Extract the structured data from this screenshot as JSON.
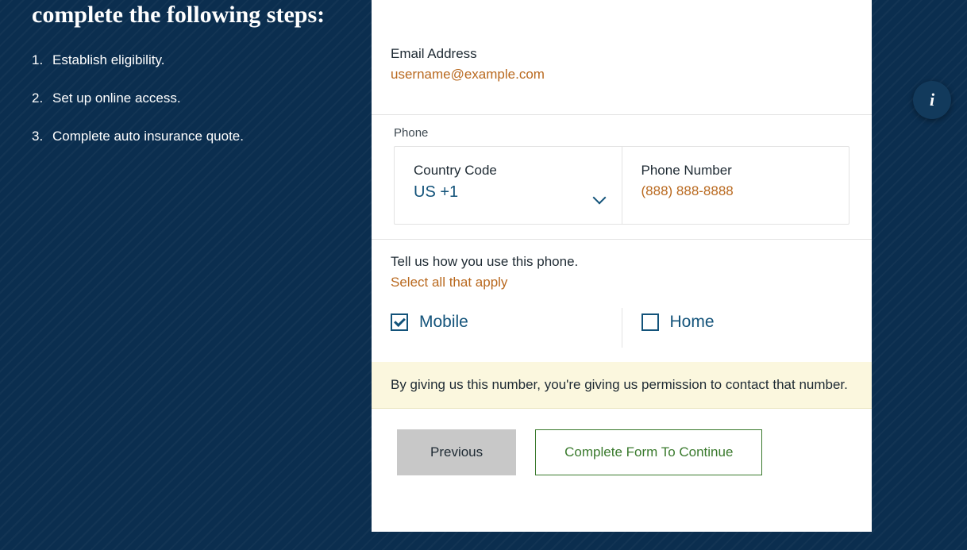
{
  "sidebar": {
    "heading": "complete the following steps:",
    "steps": [
      "Establish eligibility.",
      "Set up online access.",
      "Complete auto insurance quote."
    ]
  },
  "form": {
    "email": {
      "label": "Email Address",
      "value": "username@example.com"
    },
    "phone": {
      "section_label": "Phone",
      "country_code": {
        "label": "Country Code",
        "value": "US +1"
      },
      "number": {
        "label": "Phone Number",
        "value": "(888) 888-8888"
      }
    },
    "usage": {
      "prompt": "Tell us how you use this phone.",
      "hint": "Select all that apply",
      "options": [
        {
          "label": "Mobile",
          "checked": true
        },
        {
          "label": "Home",
          "checked": false
        }
      ]
    },
    "permission_note": "By giving us this number, you're giving us permission to contact that number.",
    "buttons": {
      "previous": "Previous",
      "continue": "Complete Form To Continue"
    }
  },
  "info_icon": "i"
}
